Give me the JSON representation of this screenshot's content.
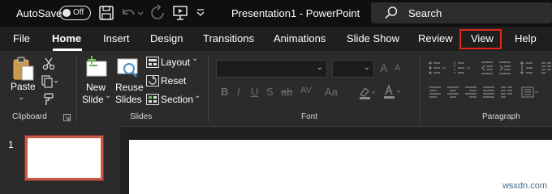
{
  "titlebar": {
    "autosave_label": "AutoSave",
    "autosave_state": "Off",
    "document_title": "Presentation1  -  PowerPoint",
    "search_placeholder": "Search"
  },
  "tabs": [
    {
      "label": "File"
    },
    {
      "label": "Home"
    },
    {
      "label": "Insert"
    },
    {
      "label": "Design"
    },
    {
      "label": "Transitions"
    },
    {
      "label": "Animations"
    },
    {
      "label": "Slide Show"
    },
    {
      "label": "Review"
    },
    {
      "label": "View"
    },
    {
      "label": "Help"
    }
  ],
  "ribbon": {
    "clipboard": {
      "paste_label": "Paste",
      "group_label": "Clipboard"
    },
    "slides": {
      "new_slide_line1": "New",
      "new_slide_line2": "Slide",
      "reuse_line1": "Reuse",
      "reuse_line2": "Slides",
      "layout_label": "Layout",
      "reset_label": "Reset",
      "section_label": "Section",
      "group_label": "Slides"
    },
    "font": {
      "group_label": "Font"
    },
    "paragraph": {
      "group_label": "Paragraph"
    }
  },
  "thumbnails": {
    "slide_number": "1"
  },
  "watermark": "wsxdn.com",
  "colors": {
    "titlebar_bg": "#0f0f0f",
    "tab_bar_bg": "#1f1f1f",
    "ribbon_bg": "#2b2b2b",
    "view_highlight": "#e0281a",
    "thumb_border": "#c8594b"
  }
}
